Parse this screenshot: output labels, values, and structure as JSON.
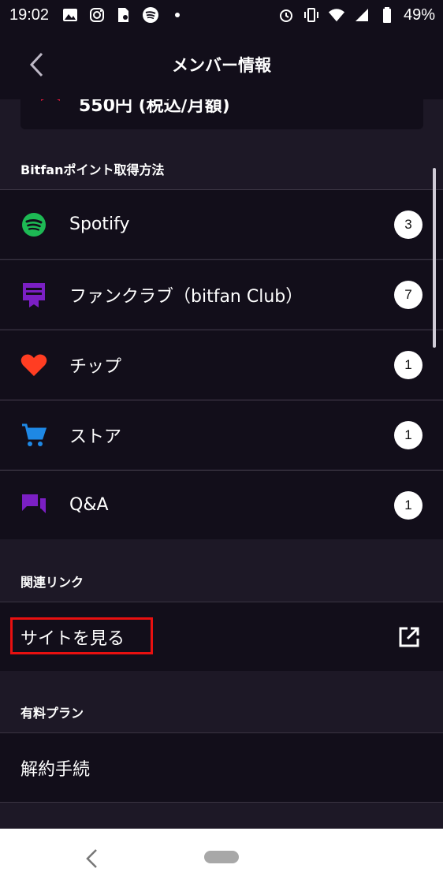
{
  "status_bar": {
    "time": "19:02",
    "battery": "49%"
  },
  "app_bar": {
    "title": "メンバー情報"
  },
  "plan_card": {
    "price": "550円 (税込/月額)"
  },
  "points_section": {
    "title": "Bitfanポイント取得方法",
    "items": [
      {
        "label": "Spotify",
        "count": "3",
        "icon": "spotify-icon",
        "color": "#1db954"
      },
      {
        "label": "ファンクラブ（bitfan Club）",
        "count": "7",
        "icon": "fanclub-icon",
        "color": "#7b1fc4"
      },
      {
        "label": "チップ",
        "count": "1",
        "icon": "heart-icon",
        "color": "#ff3d22"
      },
      {
        "label": "ストア",
        "count": "1",
        "icon": "cart-icon",
        "color": "#1e88e5"
      },
      {
        "label": "Q&A",
        "count": "1",
        "icon": "chat-icon",
        "color": "#7b1fc4"
      }
    ]
  },
  "links_section": {
    "title": "関連リンク",
    "site_link": "サイトを見る"
  },
  "plan_section": {
    "title": "有料プラン",
    "cancel": "解約手続"
  },
  "colors": {
    "background": "#1d1826",
    "row_background": "#120e1a",
    "highlight": "#e81010"
  }
}
